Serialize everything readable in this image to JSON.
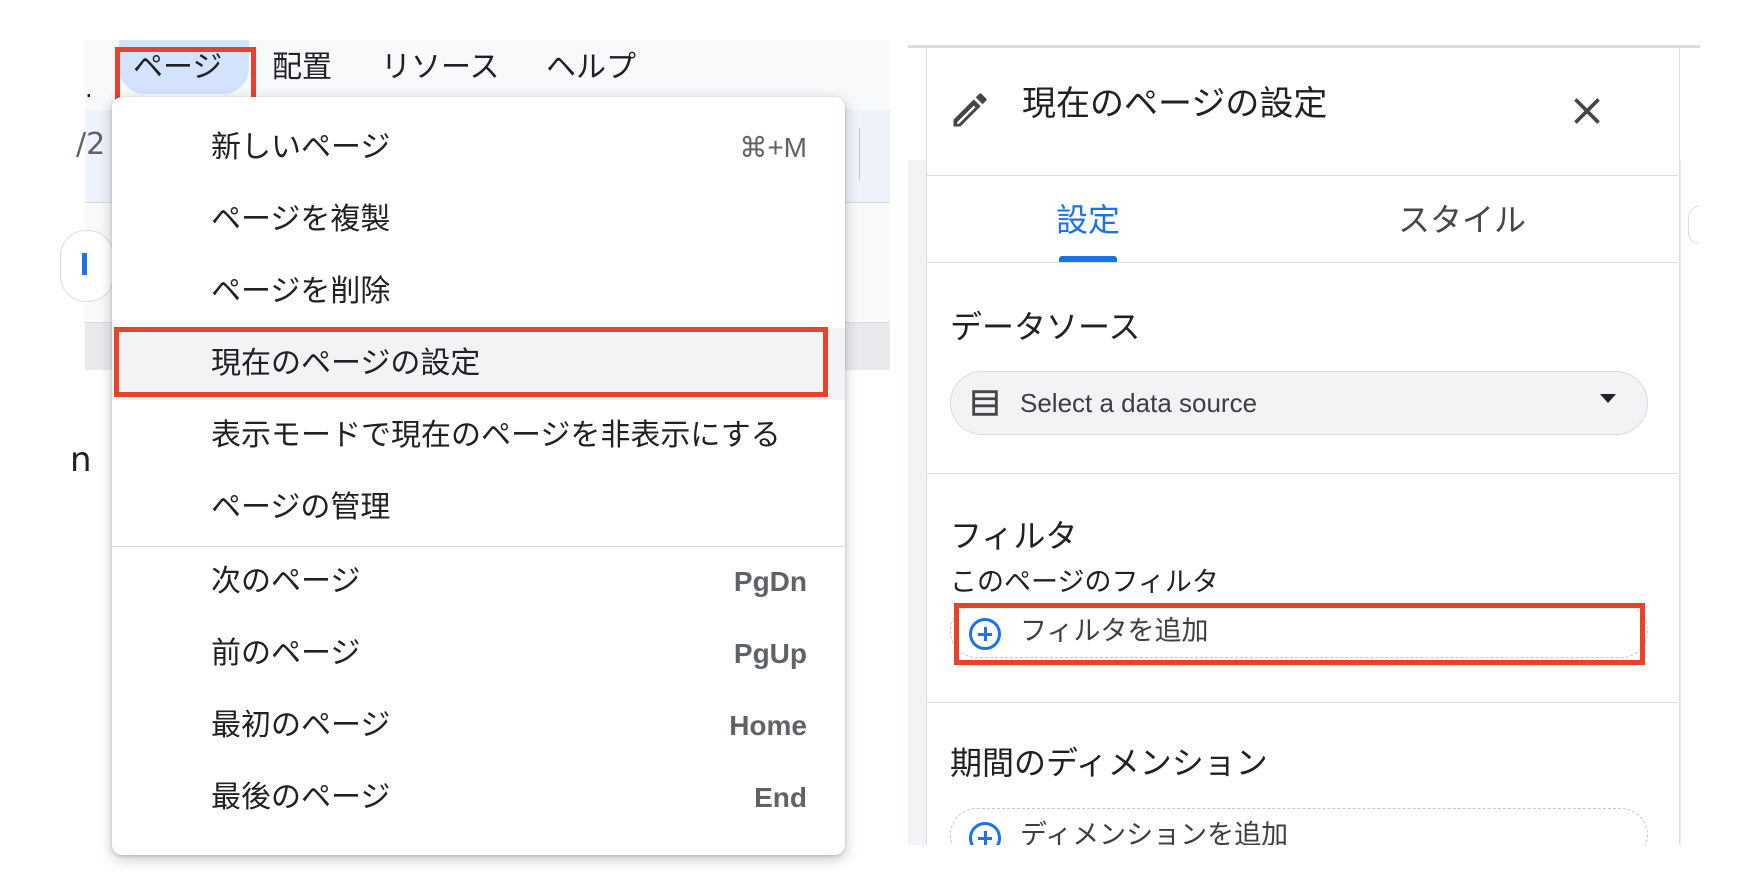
{
  "menubar": {
    "items": [
      "ページ",
      "配置",
      "リソース",
      "ヘルプ"
    ],
    "fragments": [
      "/2",
      "n"
    ]
  },
  "page_menu": {
    "items": [
      {
        "label": "新しいページ",
        "shortcut": "⌘+M"
      },
      {
        "label": "ページを複製",
        "shortcut": ""
      },
      {
        "label": "ページを削除",
        "shortcut": ""
      },
      {
        "label": "現在のページの設定",
        "shortcut": ""
      },
      {
        "label": "表示モードで現在のページを非表示にする",
        "shortcut": ""
      },
      {
        "label": "ページの管理",
        "shortcut": ""
      },
      {
        "label": "次のページ",
        "shortcut": "PgDn"
      },
      {
        "label": "前のページ",
        "shortcut": "PgUp"
      },
      {
        "label": "最初のページ",
        "shortcut": "Home"
      },
      {
        "label": "最後のページ",
        "shortcut": "End"
      }
    ]
  },
  "panel": {
    "title": "現在のページの設定",
    "tabs": [
      "設定",
      "スタイル"
    ],
    "data_source": {
      "title": "データソース",
      "select_text": "Select a data source"
    },
    "filter": {
      "title": "フィルタ",
      "subtitle": "このページのフィルタ",
      "add_label": "フィルタを追加"
    },
    "date_dimension": {
      "title": "期間のディメンション",
      "add_label": "ディメンションを追加"
    }
  },
  "colors": {
    "accent_blue": "#1a73e8",
    "highlight_red": "#e8412c",
    "chip_blue": "#d3e3fd"
  }
}
